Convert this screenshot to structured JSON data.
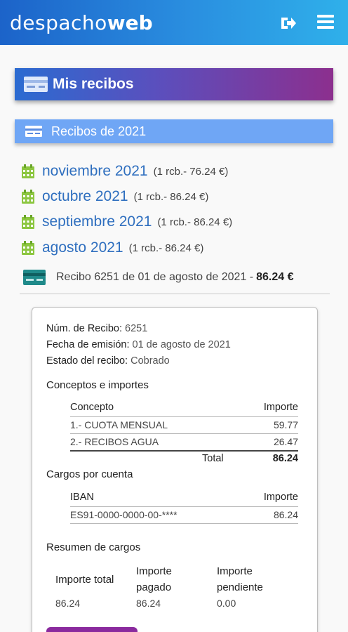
{
  "header": {
    "logo_text": "despacho",
    "logo_bold": "web",
    "icons": [
      "logout-icon",
      "hamburger-menu-icon"
    ]
  },
  "page": {
    "title": "Mis recibos",
    "year_section": "Recibos de 2021"
  },
  "months": [
    {
      "name": "noviembre 2021",
      "info": "(1 rcb.- 76.24 €)"
    },
    {
      "name": "octubre 2021",
      "info": "(1 rcb.- 86.24 €)"
    },
    {
      "name": "septiembre 2021",
      "info": "(1 rcb.- 86.24 €)"
    },
    {
      "name": "agosto 2021",
      "info": "(1 rcb.- 86.24 €)"
    }
  ],
  "receipt": {
    "summary": "Recibo 6251 de 01 de agosto de 2021 -",
    "amount": "86.24 €",
    "number_label": "Núm. de Recibo:",
    "number_value": "6251",
    "date_label": "Fecha de emisión:",
    "date_value": "01 de agosto de 2021",
    "status_label": "Estado del recibo:",
    "status_value": "Cobrado",
    "concepts_title": "Conceptos e importes",
    "concepts_header": {
      "concept": "Concepto",
      "amount": "Importe"
    },
    "concepts": [
      {
        "concept": "1.- CUOTA MENSUAL",
        "amount": "59.77"
      },
      {
        "concept": "2.- RECIBOS AGUA",
        "amount": "26.47"
      }
    ],
    "total_label": "Total",
    "total_value": "86.24",
    "charges_title": "Cargos por cuenta",
    "charges_header": {
      "iban": "IBAN",
      "amount": "Importe"
    },
    "charges": [
      {
        "iban": "ES91-0000-0000-00-****",
        "amount": "86.24"
      }
    ],
    "summary_title": "Resumen de cargos",
    "summary_headers": {
      "total": "Importe total",
      "paid_line1": "Importe",
      "paid_line2": "pagado",
      "pending_line1": "Importe",
      "pending_line2": "pendiente"
    },
    "summary_values": {
      "total": "86.24",
      "paid": "86.24",
      "pending": "0.00"
    }
  },
  "colors": {
    "header_gradient_start": "#1c63c9",
    "header_gradient_end": "#2fb0ea",
    "title_gradient_start": "#2b6bd1",
    "title_gradient_end": "#8c2f8e",
    "year_bar": "#6fa6f5",
    "month_link": "#2f6fbf",
    "calendar_icon": "#8cc63f",
    "pay_button": "#8a2a9e"
  }
}
